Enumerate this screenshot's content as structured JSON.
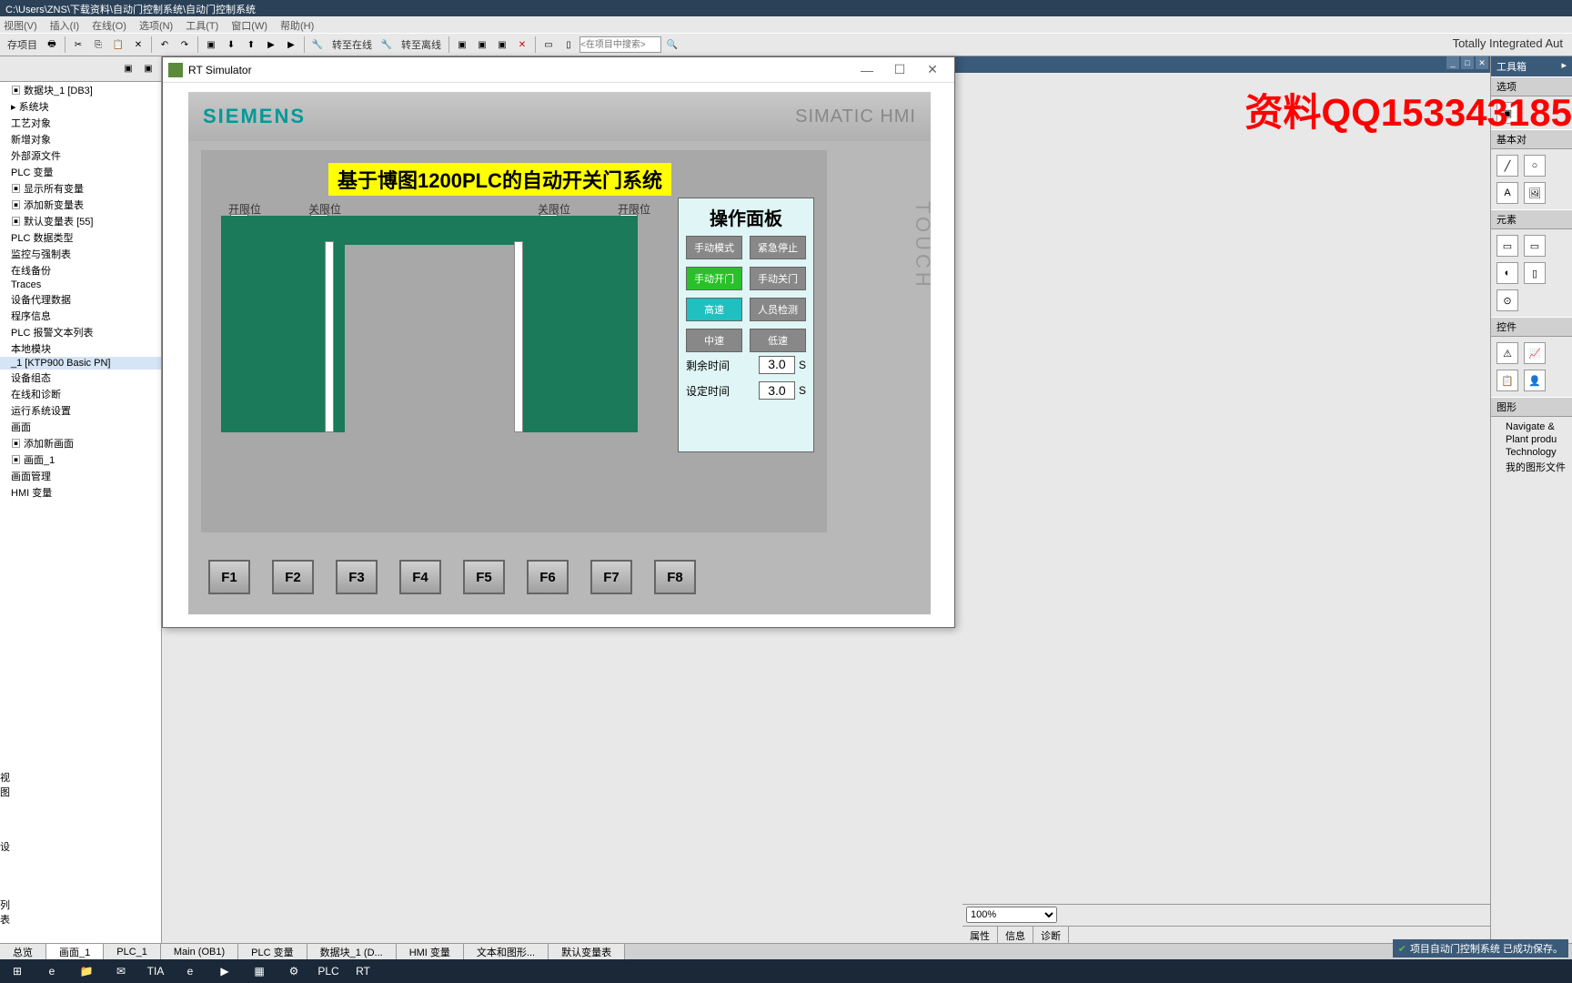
{
  "titlebar": "C:\\Users\\ZNS\\下载资料\\自动门控制系统\\自动门控制系统",
  "menubar": [
    "视图(V)",
    "插入(I)",
    "在线(O)",
    "选项(N)",
    "工具(T)",
    "窗口(W)",
    "帮助(H)"
  ],
  "toolbar": {
    "save_label": "存项目",
    "go_online": "转至在线",
    "go_offline": "转至离线",
    "search_placeholder": "<在项目中搜索>"
  },
  "tia_label": "Totally Integrated Aut",
  "tree": [
    {
      "label": "数据块_1 [DB3]",
      "icon": "▣"
    },
    {
      "label": "系统块",
      "icon": "▸"
    },
    {
      "label": "工艺对象",
      "icon": ""
    },
    {
      "label": "新增对象",
      "icon": ""
    },
    {
      "label": "外部源文件",
      "icon": ""
    },
    {
      "label": "PLC 变量",
      "icon": ""
    },
    {
      "label": "显示所有变量",
      "icon": "▣"
    },
    {
      "label": "添加新变量表",
      "icon": "▣"
    },
    {
      "label": "默认变量表 [55]",
      "icon": "▣"
    },
    {
      "label": "PLC 数据类型",
      "icon": ""
    },
    {
      "label": "监控与强制表",
      "icon": ""
    },
    {
      "label": "在线备份",
      "icon": ""
    },
    {
      "label": "Traces",
      "icon": ""
    },
    {
      "label": "设备代理数据",
      "icon": ""
    },
    {
      "label": "程序信息",
      "icon": ""
    },
    {
      "label": "PLC 报警文本列表",
      "icon": ""
    },
    {
      "label": "本地模块",
      "icon": ""
    },
    {
      "label": "_1 [KTP900 Basic PN]",
      "icon": "",
      "selected": true
    },
    {
      "label": "设备组态",
      "icon": ""
    },
    {
      "label": "在线和诊断",
      "icon": ""
    },
    {
      "label": "运行系统设置",
      "icon": ""
    },
    {
      "label": "画面",
      "icon": ""
    },
    {
      "label": "添加新画面",
      "icon": "▣"
    },
    {
      "label": "画面_1",
      "icon": "▣"
    },
    {
      "label": "画面管理",
      "icon": ""
    },
    {
      "label": "HMI 变量",
      "icon": ""
    }
  ],
  "tree_bottom": [
    "视图",
    "设",
    "列表"
  ],
  "simulator": {
    "title": "RT Simulator",
    "logo": "SIEMENS",
    "brand": "SIMATIC HMI",
    "touch_label": "TOUCH",
    "screen_title": "基于博图1200PLC的自动开关门系统",
    "limit_labels": [
      "开限位",
      "关限位",
      "关限位",
      "开限位"
    ],
    "panel_title": "操作面板",
    "buttons": [
      {
        "label": "手动模式",
        "class": ""
      },
      {
        "label": "紧急停止",
        "class": ""
      },
      {
        "label": "手动开门",
        "class": "green"
      },
      {
        "label": "手动关门",
        "class": ""
      },
      {
        "label": "高速",
        "class": "cyan"
      },
      {
        "label": "人员检测",
        "class": ""
      },
      {
        "label": "中速",
        "class": ""
      },
      {
        "label": "低速",
        "class": ""
      }
    ],
    "remain_label": "剩余时间",
    "remain_val": "3.0",
    "set_label": "设定时间",
    "set_val": "3.0",
    "unit": "S",
    "fkeys": [
      "F1",
      "F2",
      "F3",
      "F4",
      "F5",
      "F6",
      "F7",
      "F8"
    ]
  },
  "right_panel": {
    "title": "工具箱",
    "sections": [
      "选项",
      "基本对",
      "元素",
      "控件",
      "图形"
    ],
    "zoom": "100%",
    "tabs": [
      "属性",
      "信息",
      "诊断"
    ],
    "graphics_tree": [
      "Navigate &",
      "Plant produ",
      "Technology",
      "我的图形文件"
    ]
  },
  "doc_tabs": [
    "总览",
    "画面_1",
    "PLC_1",
    "Main (OB1)",
    "PLC 变量",
    "数据块_1 (D...",
    "HMI 变量",
    "文本和图形...",
    "默认变量表"
  ],
  "status_text": "项目自动门控制系统 已成功保存。",
  "watermark": "资料QQ153343185",
  "taskbar_icons": [
    "⊞",
    "e",
    "📁",
    "✉",
    "TIA",
    "e",
    "▶",
    "▦",
    "⚙",
    "PLC",
    "RT"
  ]
}
